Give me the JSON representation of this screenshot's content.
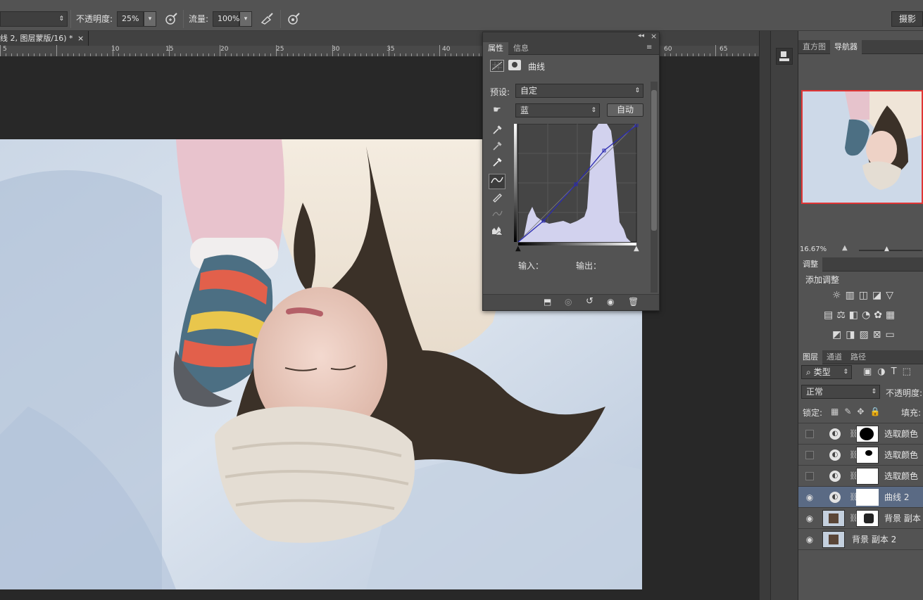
{
  "options_bar": {
    "opacity_label": "不透明度:",
    "opacity_value": "25%",
    "flow_label": "流量:",
    "flow_value": "100%",
    "workspace_button": "摄影"
  },
  "document": {
    "tab_title": "线 2, 图层蒙版/16) *",
    "close_glyph": "×"
  },
  "ruler": {
    "labels": [
      "5",
      "10",
      "15",
      "20",
      "25",
      "30",
      "35",
      "40",
      "45",
      "60",
      "65"
    ]
  },
  "properties_panel": {
    "tabs": [
      "属性",
      "信息"
    ],
    "active_tab": "属性",
    "panel_title": "曲线",
    "preset_label": "预设:",
    "preset_value": "自定",
    "channel_value": "蓝",
    "auto_button": "自动",
    "input_label": "输入：",
    "output_label": "输出：",
    "curve_color": "#2b2bb0",
    "histogram_color": "#d2d2ee"
  },
  "navigator_panel": {
    "tabs": [
      "直方图",
      "导航器"
    ],
    "active_tab": "导航器",
    "zoom": "16.67%",
    "viewbox_color": "#e03535"
  },
  "adjustments_panel": {
    "tab": "调整",
    "add_label": "添加调整"
  },
  "layers_panel": {
    "tabs": [
      "图层",
      "通道",
      "路径"
    ],
    "active_tab": "图层",
    "filter_label": "类型",
    "blend_mode": "正常",
    "opacity_label": "不透明度:",
    "lock_label": "锁定:",
    "fill_label": "填充:",
    "layers": [
      {
        "name": "选取颜色",
        "visible": false,
        "selected": false
      },
      {
        "name": "选取颜色",
        "visible": false,
        "selected": false
      },
      {
        "name": "选取颜色",
        "visible": false,
        "selected": false
      },
      {
        "name": "曲线 2",
        "visible": true,
        "selected": true
      },
      {
        "name": "背景 副本",
        "visible": true,
        "selected": false
      },
      {
        "name": "背景 副本 2",
        "visible": true,
        "selected": false
      }
    ]
  }
}
